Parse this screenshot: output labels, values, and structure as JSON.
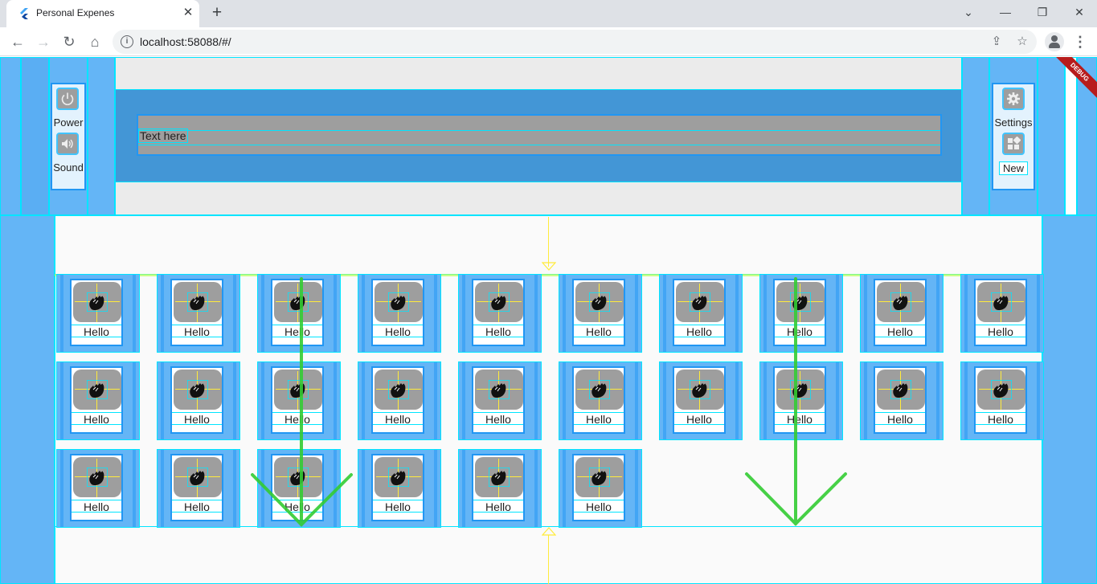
{
  "browser": {
    "tab_title": "Personal Expenes",
    "tab_close": "✕",
    "new_tab": "+",
    "url": "localhost:58088/#/",
    "window_controls": {
      "chevron": "⌄",
      "minimize": "—",
      "restore": "❐",
      "close": "✕"
    },
    "nav": {
      "back": "←",
      "forward": "→",
      "reload": "↻",
      "home": "⌂"
    }
  },
  "app": {
    "debug_banner": "DEBUG",
    "left_panel": {
      "buttons": [
        {
          "label": "Power",
          "icon": "power-icon"
        },
        {
          "label": "Sound",
          "icon": "volume-icon"
        }
      ]
    },
    "right_panel": {
      "buttons": [
        {
          "label": "Settings",
          "icon": "gear-icon"
        },
        {
          "label": "New",
          "icon": "dashboard-icon"
        }
      ]
    },
    "text_field": {
      "hint": "Text here"
    },
    "grid": {
      "item_label": "Hello",
      "item_icon": "waving-hand-icon",
      "rows": [
        10,
        10,
        6
      ]
    }
  },
  "colors": {
    "light_blue": "#64b5f6",
    "blue": "#2196f3",
    "band_blue": "#4396d6",
    "cyan_outline": "#00e5ff",
    "grey": "#9e9e9e",
    "overlay_green": "#33cc33",
    "debug_red": "#b71c1c"
  }
}
